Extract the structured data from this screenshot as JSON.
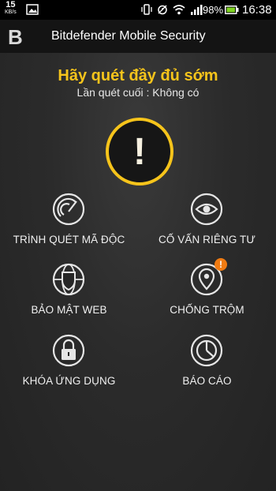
{
  "status_bar": {
    "net_speed": "15",
    "net_unit": "KB/s",
    "battery_percent": "98%",
    "time": "16:38"
  },
  "app_bar": {
    "logo_letter": "B",
    "title": "Bitdefender Mobile Security"
  },
  "scan_banner": {
    "headline": "Hãy quét đầy đủ sớm",
    "last_scan": "Lần quét cuối : Không có",
    "alert_symbol": "!"
  },
  "features": [
    {
      "label": "TRÌNH QUÉT MÃ ĐỘC",
      "icon": "malware-scanner-icon"
    },
    {
      "label": "CỐ VẤN RIÊNG TƯ",
      "icon": "eye-icon"
    },
    {
      "label": "BẢO MẬT WEB",
      "icon": "web-shield-icon"
    },
    {
      "label": "CHỐNG TRỘM",
      "icon": "location-pin-icon",
      "badge": "!"
    },
    {
      "label": "KHÓA ỨNG DỤNG",
      "icon": "padlock-icon"
    },
    {
      "label": "BÁO CÁO",
      "icon": "pie-chart-icon"
    }
  ],
  "colors": {
    "accent": "#f6c41b",
    "badge": "#f07b12",
    "background": "#262626"
  }
}
